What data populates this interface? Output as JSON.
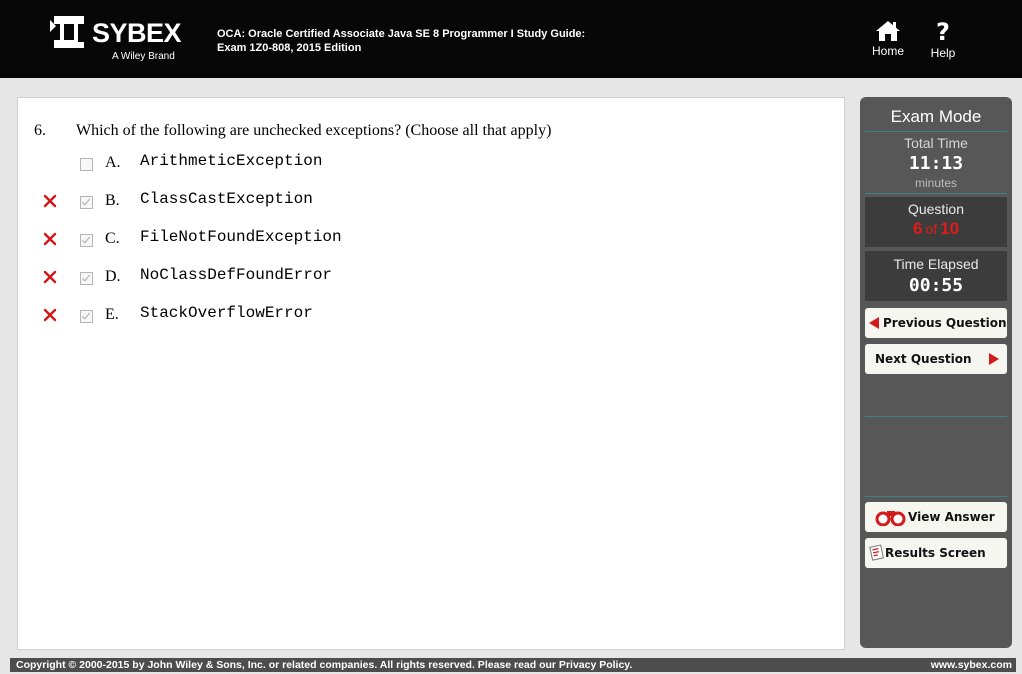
{
  "header": {
    "brand": "SYBEX",
    "brand_tagline": "A Wiley Brand",
    "title_line1": "OCA: Oracle Certified Associate Java SE 8 Programmer I Study Guide:",
    "title_line2": "Exam 1Z0-808, 2015 Edition",
    "home_label": "Home",
    "help_label": "Help",
    "help_glyph": "?",
    "home_icon": "home-icon",
    "help_icon": "question-icon"
  },
  "question": {
    "number": "6.",
    "text": "Which of the following are unchecked exceptions? (Choose all that apply)",
    "options": [
      {
        "letter": "A.",
        "text": "ArithmeticException",
        "checked": false,
        "wrong_mark": false
      },
      {
        "letter": "B.",
        "text": "ClassCastException",
        "checked": true,
        "wrong_mark": true
      },
      {
        "letter": "C.",
        "text": "FileNotFoundException",
        "checked": true,
        "wrong_mark": true
      },
      {
        "letter": "D.",
        "text": "NoClassDefFoundError",
        "checked": true,
        "wrong_mark": true
      },
      {
        "letter": "E.",
        "text": "StackOverflowError",
        "checked": true,
        "wrong_mark": true
      }
    ]
  },
  "side": {
    "mode": "Exam Mode",
    "total_time_label": "Total Time",
    "total_time_value": "11:13",
    "total_time_unit": "minutes",
    "question_label": "Question",
    "question_current": "6",
    "question_of": "of",
    "question_total": "10",
    "elapsed_label": "Time Elapsed",
    "elapsed_value": "00:55",
    "prev_label": "Previous Question",
    "next_label": "Next Question",
    "view_answer_label": "View Answer",
    "results_label": "Results Screen",
    "accent_color": "#e21b1b"
  },
  "footer": {
    "copyright": "Copyright © 2000-2015 by John Wiley & Sons, Inc. or related companies. All rights reserved. Please read our Privacy Policy.",
    "site": "www.sybex.com"
  }
}
